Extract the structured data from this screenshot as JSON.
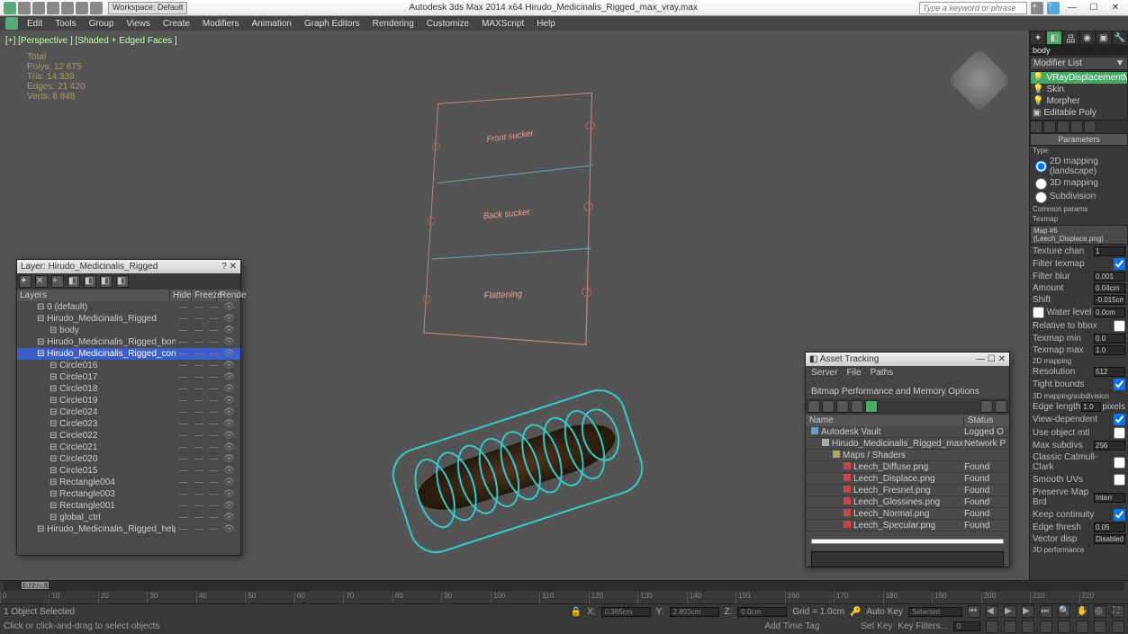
{
  "title": "Autodesk 3ds Max  2014 x64     Hirudo_Medicinalis_Rigged_max_vray.max",
  "workspace": "Workspace: Default",
  "search_placeholder": "Type a keyword or phrase",
  "menu": [
    "Edit",
    "Tools",
    "Group",
    "Views",
    "Create",
    "Modifiers",
    "Animation",
    "Graph Editors",
    "Rendering",
    "Customize",
    "MAXScript",
    "Help"
  ],
  "viewport_label": "[+] [Perspective ] [Shaded + Edged Faces ]",
  "stats": {
    "title": "Total",
    "polys": "Polys:    12 675",
    "tris": "Tris:      14 339",
    "edges": "Edges:   21 420",
    "verts": "Verts:     8 848"
  },
  "controls": {
    "c1": "Front sucker",
    "c2": "Back sucker",
    "c3": "Flattening"
  },
  "modifier": {
    "obj_name": "body",
    "list_label": "Modifier List",
    "stack": [
      "VRayDisplacementMod",
      "Skin",
      "Morpher",
      "Editable Poly"
    ]
  },
  "params": {
    "header": "Parameters",
    "type": "Type",
    "opt1": "2D mapping (landscape)",
    "opt2": "3D mapping",
    "opt3": "Subdivision",
    "common": "Common params",
    "texmap": "Texmap",
    "mapname": "Map #6 (Leech_Displace.png)",
    "texchan": "Texture chan",
    "texchan_v": "1",
    "filtertm": "Filter texmap",
    "filterblur": "Filter blur",
    "filterblur_v": "0.001",
    "amount": "Amount",
    "amount_v": "0.04cm",
    "shift": "Shift",
    "shift_v": "-0.015cm",
    "waterlvl": "Water level",
    "waterlvl_v": "0.0cm",
    "relbbox": "Relative to bbox",
    "tmin": "Texmap min",
    "tmin_v": "0.0",
    "tmax": "Texmap max",
    "tmax_v": "1.0",
    "sec2d": "2D mapping",
    "resolution": "Resolution",
    "resolution_v": "512",
    "tightbounds": "Tight bounds",
    "sec3d": "3D mapping/subdivision",
    "edgelen": "Edge length",
    "edgelen_v": "1.0",
    "edgelen_unit": "pixels",
    "viewdep": "View-dependent",
    "useobjmtl": "Use object mtl",
    "maxsub": "Max subdivs",
    "maxsub_v": "256",
    "catmull": "Classic Catmull-Clark",
    "smoothuv": "Smooth UVs",
    "preserve": "Preserve Map Brd",
    "preserve_v": "Interr",
    "keepcont": "Keep continuity",
    "edgethr": "Edge thresh",
    "edgethr_v": "0.05",
    "vecdisp": "Vector disp",
    "vecdisp_v": "Disabled",
    "perf": "3D performance"
  },
  "layer_panel": {
    "title": "Layer: Hirudo_Medicinalis_Rigged",
    "cols": {
      "layers": "Layers",
      "hide": "Hide",
      "freeze": "Freeze",
      "render": "Rende"
    },
    "rows": [
      {
        "name": "0 (default)",
        "lvl": 1
      },
      {
        "name": "Hirudo_Medicinalis_Rigged",
        "lvl": 1
      },
      {
        "name": "body",
        "lvl": 2
      },
      {
        "name": "Hirudo_Medicinalis_Rigged_bones",
        "lvl": 1
      },
      {
        "name": "Hirudo_Medicinalis_Rigged_controllers",
        "lvl": 1,
        "selected": true
      },
      {
        "name": "Circle016",
        "lvl": 2
      },
      {
        "name": "Circle017",
        "lvl": 2
      },
      {
        "name": "Circle018",
        "lvl": 2
      },
      {
        "name": "Circle019",
        "lvl": 2
      },
      {
        "name": "Circle024",
        "lvl": 2
      },
      {
        "name": "Circle023",
        "lvl": 2
      },
      {
        "name": "Circle022",
        "lvl": 2
      },
      {
        "name": "Circle021",
        "lvl": 2
      },
      {
        "name": "Circle020",
        "lvl": 2
      },
      {
        "name": "Circle015",
        "lvl": 2
      },
      {
        "name": "Rectangle004",
        "lvl": 2
      },
      {
        "name": "Rectangle003",
        "lvl": 2
      },
      {
        "name": "Rectangle001",
        "lvl": 2
      },
      {
        "name": "global_ctrl",
        "lvl": 2
      },
      {
        "name": "Hirudo_Medicinalis_Rigged_helpers",
        "lvl": 1
      }
    ]
  },
  "asset_panel": {
    "title": "Asset Tracking",
    "menu": [
      "Server",
      "File",
      "Paths",
      "Bitmap Performance and Memory Options"
    ],
    "cols": {
      "name": "Name",
      "status": "Status"
    },
    "rows": [
      {
        "name": "Autodesk Vault",
        "status": "Logged O",
        "icon": "#69c",
        "indent": 0
      },
      {
        "name": "Hirudo_Medicinalis_Rigged_max_vray.max",
        "status": "Network P",
        "icon": "#aaa",
        "indent": 1
      },
      {
        "name": "Maps / Shaders",
        "status": "",
        "icon": "#aa6",
        "indent": 2
      },
      {
        "name": "Leech_Diffuse.png",
        "status": "Found",
        "icon": "#c44",
        "indent": 3
      },
      {
        "name": "Leech_Displace.png",
        "status": "Found",
        "icon": "#c44",
        "indent": 3
      },
      {
        "name": "Leech_Fresnel.png",
        "status": "Found",
        "icon": "#c44",
        "indent": 3
      },
      {
        "name": "Leech_Glossines.png",
        "status": "Found",
        "icon": "#c44",
        "indent": 3
      },
      {
        "name": "Leech_Normal.png",
        "status": "Found",
        "icon": "#c44",
        "indent": 3
      },
      {
        "name": "Leech_Specular.png",
        "status": "Found",
        "icon": "#c44",
        "indent": 3
      }
    ]
  },
  "timeline": {
    "slider": "0 / 225",
    "ticks": [
      "0",
      "10",
      "20",
      "30",
      "40",
      "50",
      "60",
      "70",
      "80",
      "90",
      "100",
      "110",
      "120",
      "130",
      "140",
      "150",
      "160",
      "170",
      "180",
      "190",
      "200",
      "210",
      "220"
    ]
  },
  "status": {
    "sel": "1 Object Selected",
    "x": "0.365cm",
    "y": "2.893cm",
    "z": "0.0cm",
    "grid": "Grid = 1.0cm",
    "autokey": "Auto Key",
    "selected": "Selected",
    "prompt": "Click or click-and-drag to select objects",
    "addtag": "Add Time Tag",
    "setkey": "Set Key",
    "keyfilters": "Key Filters..."
  }
}
